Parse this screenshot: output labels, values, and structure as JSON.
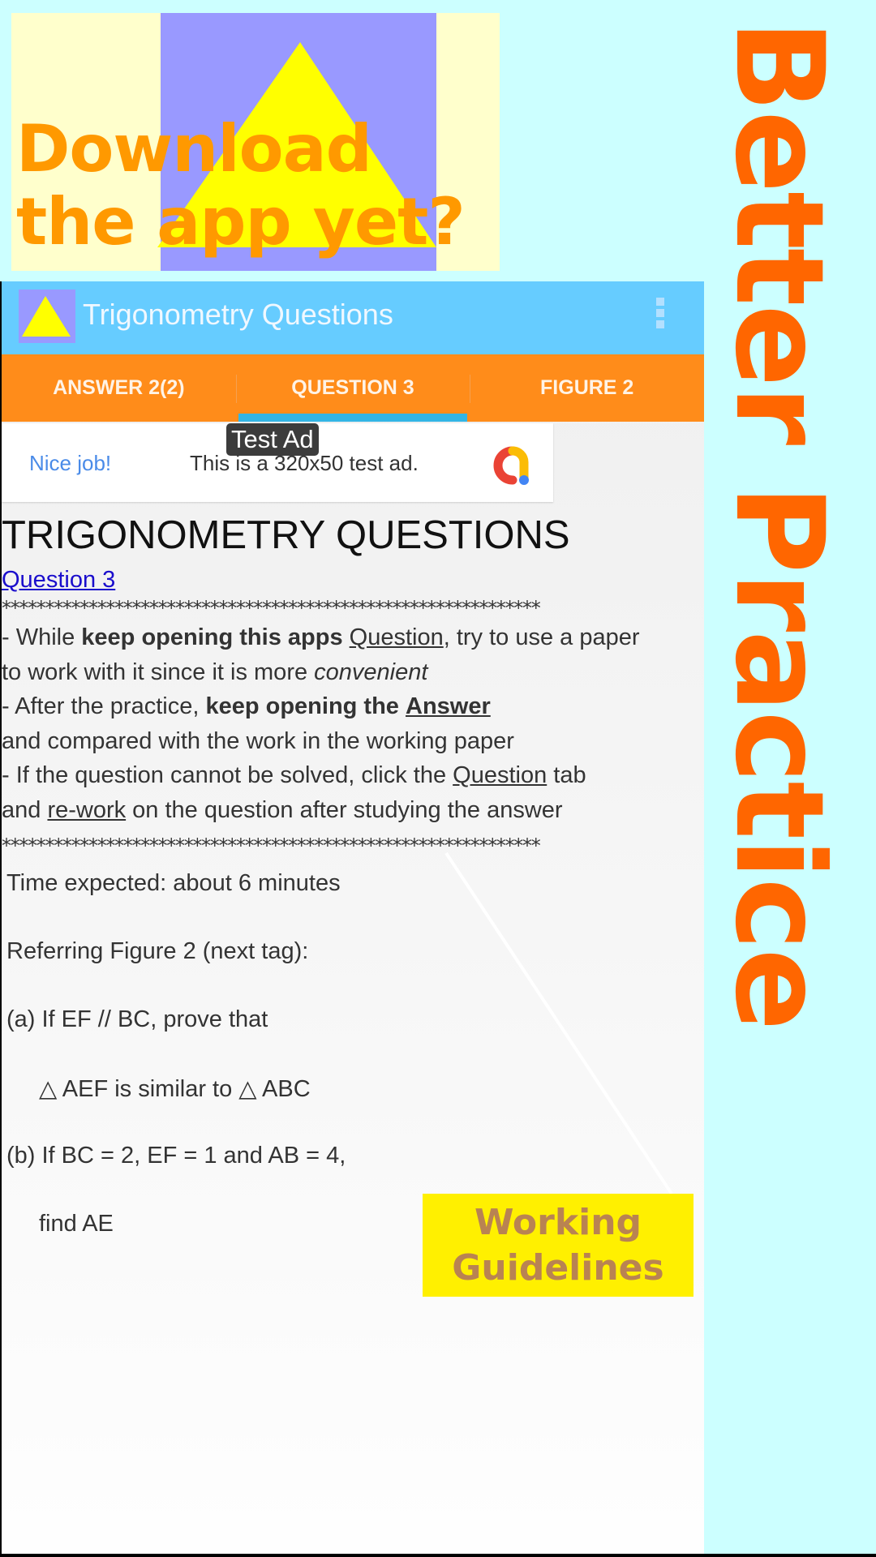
{
  "promo": {
    "line1": "Download",
    "line2": "the app yet?",
    "colors": {
      "background": "#FFFFCC",
      "panel": "#9999FF",
      "triangle": "#FFFF00",
      "text": "#FF9900"
    }
  },
  "slogan": {
    "text": "Better Practice",
    "color": "#FF6600"
  },
  "app": {
    "title": "Trigonometry Questions",
    "icon": "app-triangle-icon",
    "menu_icon": "more-vert-icon",
    "colors": {
      "toolbar": "#66CCFF",
      "tabbar": "#FF8C1A",
      "indicator": "#33B5E5"
    },
    "tabs": [
      {
        "label": "ANSWER 2(2)",
        "active": false
      },
      {
        "label": "QUESTION 3",
        "active": true
      },
      {
        "label": "FIGURE 2",
        "active": false
      }
    ]
  },
  "ad": {
    "badge": "Test Ad",
    "headline": "Nice job!",
    "text": "This is a 320x50 test ad.",
    "logo_icon": "admob-logo-icon"
  },
  "content": {
    "heading": "TRIGONOMETRY QUESTIONS",
    "link": "Question 3",
    "stars": "**************************************************************",
    "guidelines": {
      "l1_pre": "- While ",
      "l1_bold": "keep opening this apps",
      "l1_link": "Question",
      "l1_post": ", try to use a paper",
      "l2_pre": " to work with it since it is more ",
      "l2_italic": "convenient",
      "l3_pre": "- After the practice, ",
      "l3_bold": "keep opening the",
      "l3_link": "Answer",
      "l4": "and compared with the work in the working paper",
      "l5_pre": "- If the question cannot be solved, click the ",
      "l5_link": "Question",
      "l5_post": " tab",
      "l6_pre": "and ",
      "l6_link": "re-work",
      "l6_post": " on the question after studying the answer"
    },
    "time_expected": "Time expected: about 6 minutes",
    "referring": "Referring Figure 2 (next tag):",
    "part_a": "(a) If EF // BC, prove that",
    "part_a_2": "△ AEF is similar to △ ABC",
    "part_b": "(b) If BC = 2, EF = 1 and AB = 4,",
    "part_b_2": "find AE"
  },
  "callout": {
    "line1": "Working",
    "line2": "Guidelines",
    "colors": {
      "background": "#FFF000",
      "text": "#B98352"
    }
  }
}
